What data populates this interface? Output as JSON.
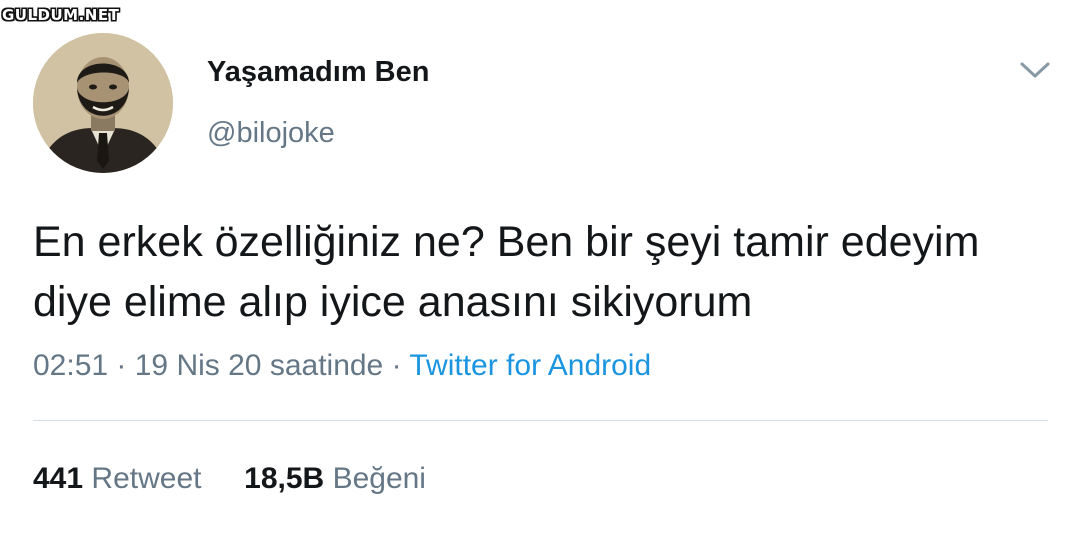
{
  "watermark": "GULDUM.NET",
  "author": {
    "display_name": "Yaşamadım Ben",
    "handle": "@bilojoke"
  },
  "tweet": {
    "text": "En erkek özelliğiniz ne? Ben bir şeyi tamir edeyim diye elime alıp iyice anasını sikiyorum"
  },
  "meta": {
    "time": "02:51",
    "sep1": " · ",
    "date": "19 Nis 20 saatinde",
    "sep2": " · ",
    "source": "Twitter for Android"
  },
  "stats": {
    "retweets_count": "441",
    "retweets_label": "Retweet",
    "likes_count": "18,5B",
    "likes_label": "Beğeni"
  },
  "icons": {
    "menu": "chevron-down-icon"
  },
  "colors": {
    "text": "#14171a",
    "secondary": "#657786",
    "link": "#1b95e0",
    "divider": "#d8dfe4"
  }
}
